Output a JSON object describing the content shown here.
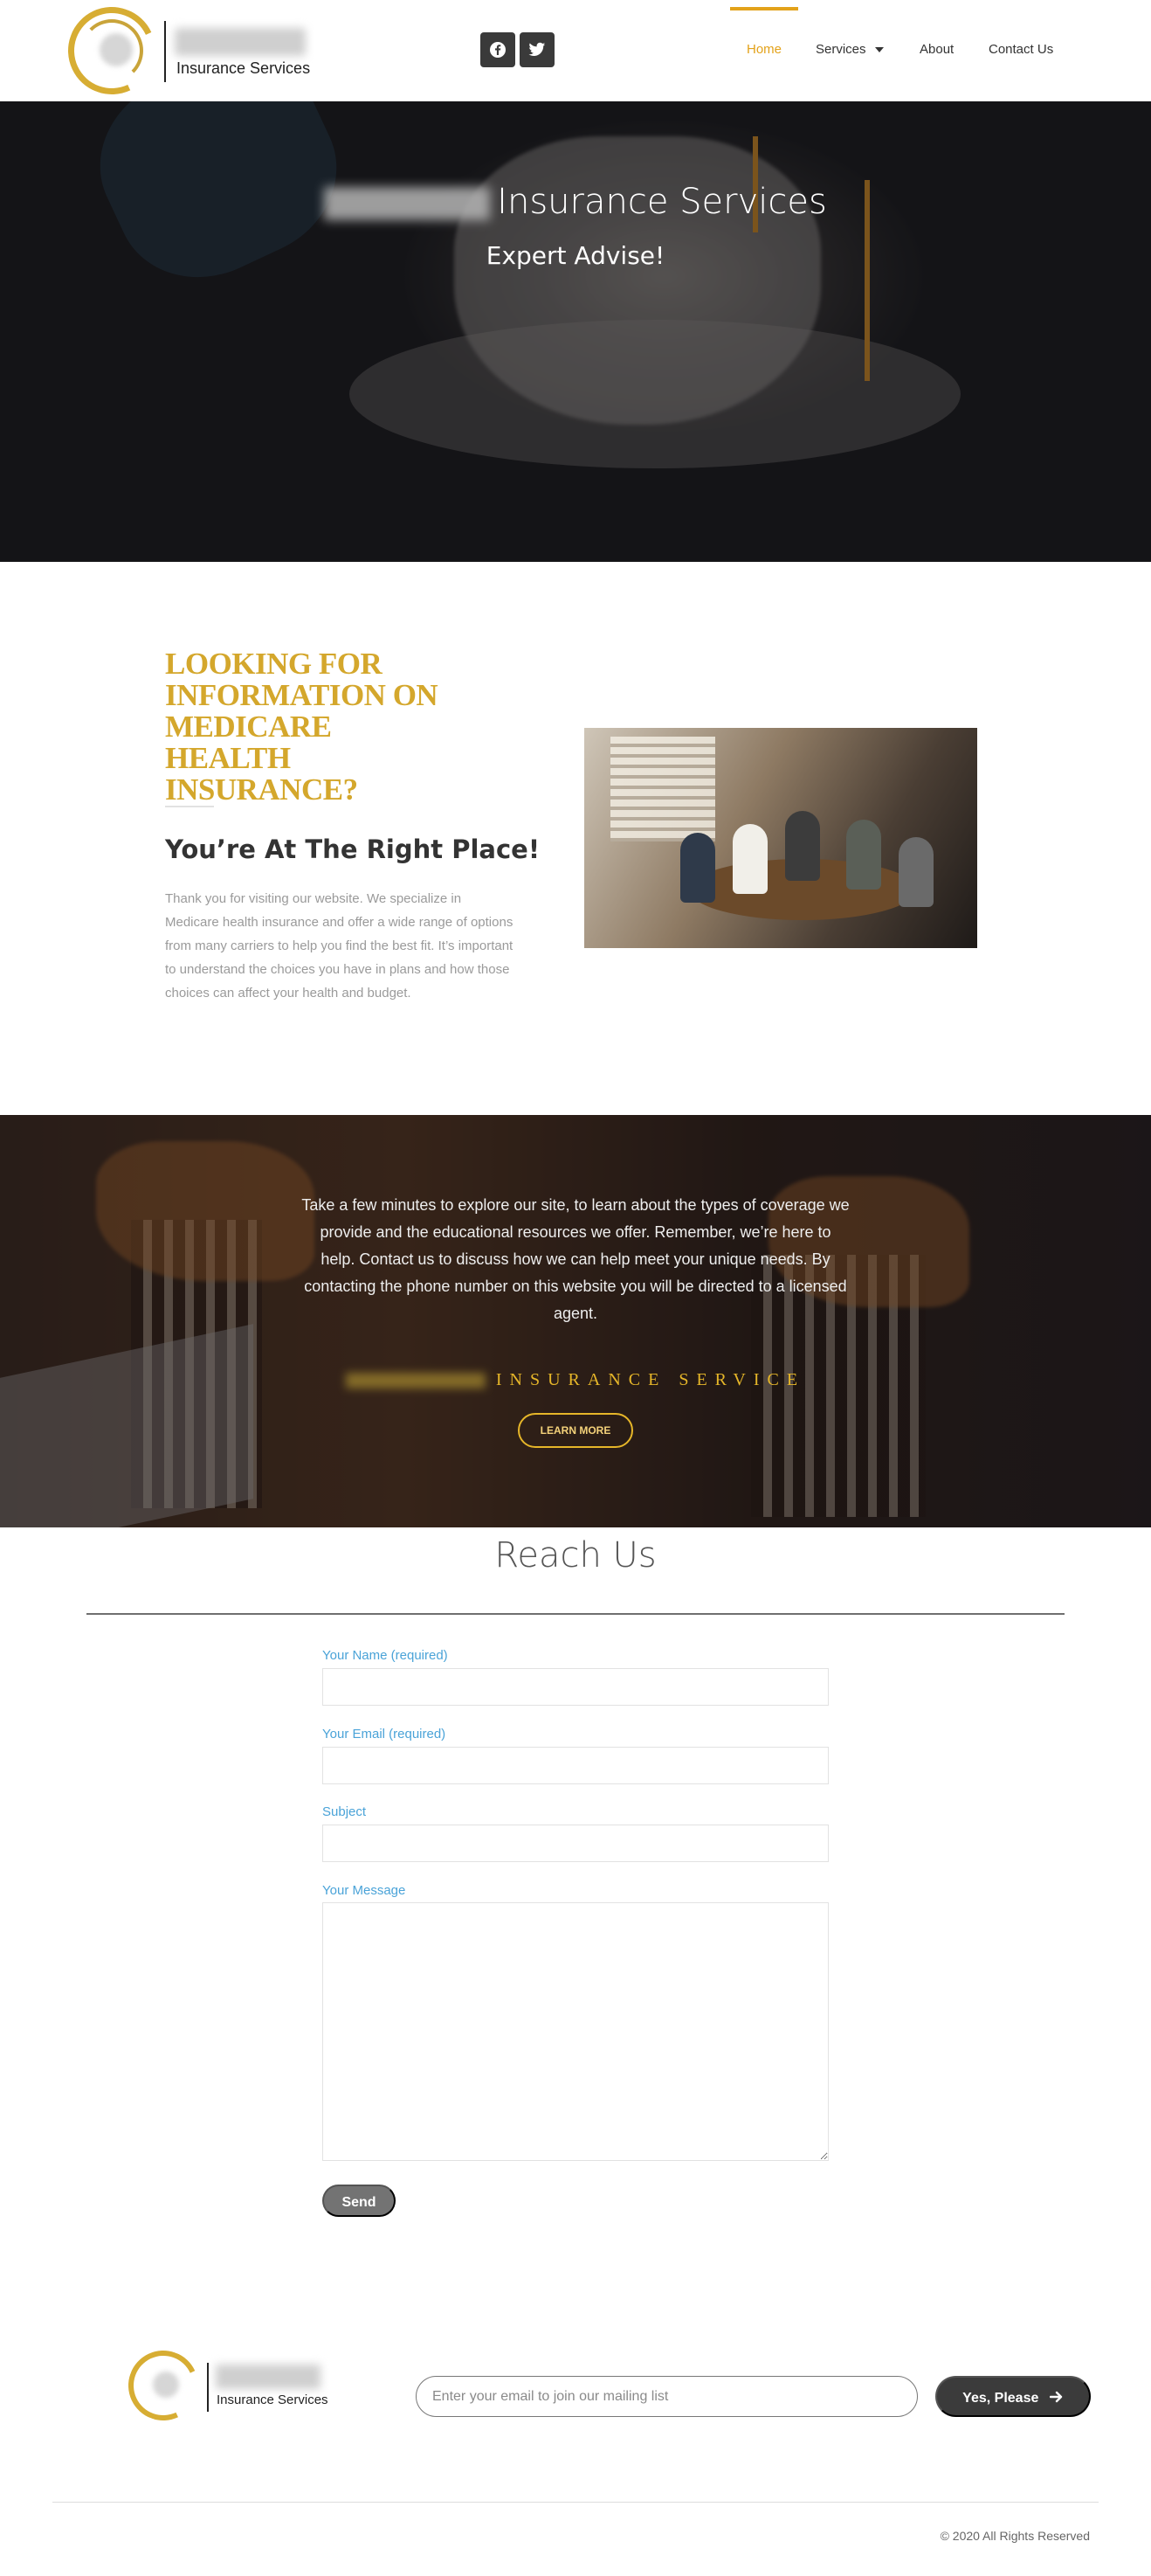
{
  "header": {
    "logo_text": "Insurance Services",
    "nav": [
      {
        "label": "Home",
        "active": true
      },
      {
        "label": "Services",
        "has_dropdown": true
      },
      {
        "label": "About"
      },
      {
        "label": "Contact Us"
      }
    ],
    "social": [
      {
        "icon": "facebook-icon"
      },
      {
        "icon": "twitter-icon"
      }
    ],
    "accent_color": "#e3a21a"
  },
  "hero": {
    "title": "Insurance Services",
    "subtitle": "Expert Advise!"
  },
  "info": {
    "heading": "LOOKING FOR INFORMATION ON MEDICARE HEALTH INSURANCE?",
    "subheading": "You’re At The Right Place!",
    "body": "Thank you for visiting our website. We specialize in Medicare health insurance and offer a wide range of options from many carriers to help you find the best fit. It’s important to understand the choices you have in plans and how those choices can affect your health and budget.",
    "heading_color": "#d4a72c"
  },
  "band": {
    "text": "Take a few minutes to explore our site, to learn about the types of coverage we provide and the educational resources we offer. Remember, we’re here to help. Contact us to discuss how we can help meet your unique needs. By contacting the phone number on this website you will be directed to a licensed agent.",
    "brand": "INSURANCE SERVICE",
    "button_label": "LEARN MORE"
  },
  "contact": {
    "title": "Reach Us",
    "fields": [
      {
        "label": "Your Name (required)",
        "value": ""
      },
      {
        "label": "Your Email (required)",
        "value": ""
      },
      {
        "label": "Subject",
        "value": ""
      },
      {
        "label": "Your Message",
        "value": ""
      }
    ],
    "send_label": "Send",
    "label_color": "#4aa3d8"
  },
  "footer": {
    "logo_text": "Insurance Services",
    "mail_placeholder": "Enter your email to join our mailing list",
    "subscribe_label": "Yes, Please",
    "copyright": "© 2020 All Rights Reserved"
  }
}
